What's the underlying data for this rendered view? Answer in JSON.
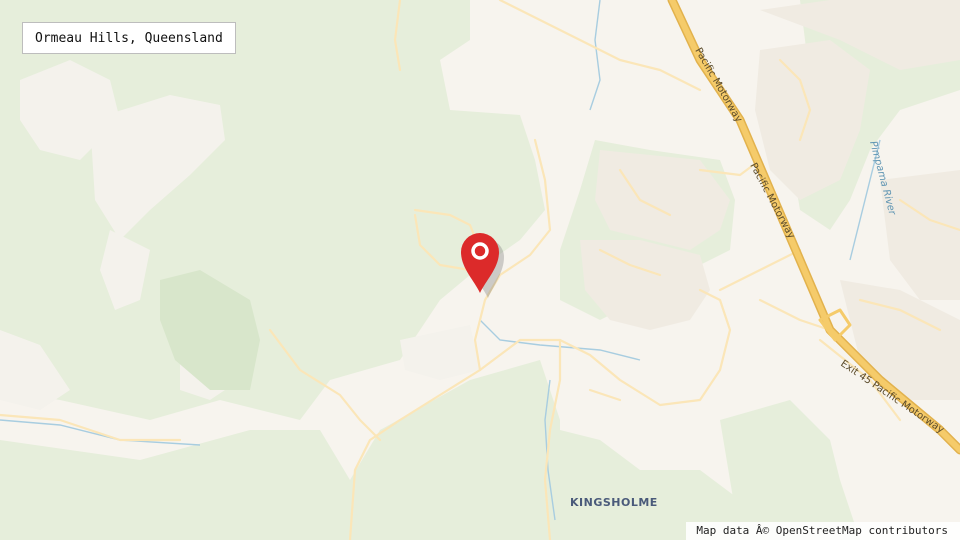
{
  "search": {
    "query": "Ormeau Hills, Queensland"
  },
  "map": {
    "labels": {
      "motorway_1": "Pacific Motorway",
      "motorway_2": "Pacific Motorway",
      "motorway_exit": "Exit 45 Pacific Motorway",
      "river": "Pimpama River",
      "suburb": "KINGSHOLME"
    },
    "marker": {
      "name": "Ormeau Hills",
      "color": "#dc2a2a"
    }
  },
  "attribution": "Map data Â© OpenStreetMap contributors",
  "colors": {
    "land": "#f7f4ee",
    "forest": "#e6eedb",
    "forest_dark": "#d8e6cb",
    "road": "#fbe6b8",
    "motorway": "#f5cb6a",
    "urban": "#f0ebe2",
    "water": "#a8cde0"
  }
}
